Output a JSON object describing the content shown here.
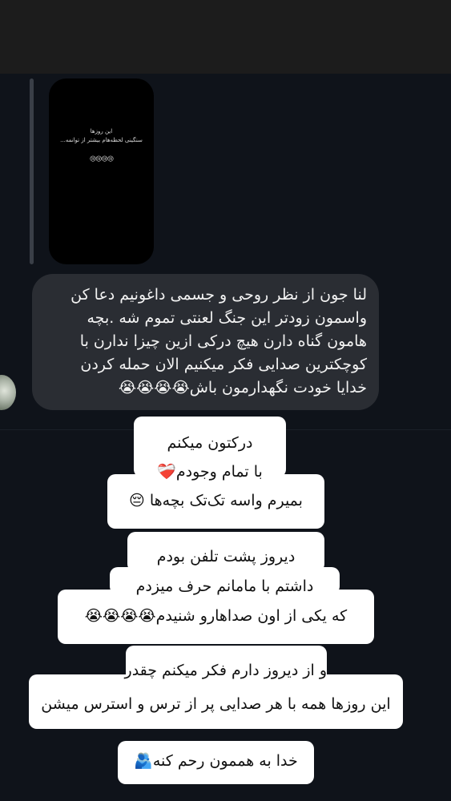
{
  "story": {
    "line1": "این روزها",
    "line2": "سنگینی لحظه‌هام بیشتر از توانمه...",
    "emoji": "😢😢😢😢"
  },
  "message": {
    "lines": [
      "لنا جون از نظر روحی و جسمی داغونیم دعا کن",
      "واسمون زودتر این جنگ لعنتی تموم شه .بچه",
      "هامون گناه دارن هیچ درکی ازین چیزا ندارن با",
      "کوچکترین صدایی فکر میکنیم الان حمله کردن",
      "خدایا خودت نگهدارمون باش😭😭😭😭"
    ]
  },
  "captions": {
    "block1": [
      "درکتون میکنم",
      "با تمام وجودم❤️‍🩹",
      "بمیرم واسه تک‌تک بچه‌ها 😔"
    ],
    "block2": [
      "دیروز پشت تلفن بودم",
      "داشتم  با مامانم حرف میزدم",
      "که یکی از اون صداهارو شنیدم😭😭😭😭"
    ],
    "block3": [
      "و از دیروز دارم فکر میکنم چقدر",
      "این روزها همه با هر صدایی پر از ترس و استرس میشن"
    ],
    "block4": [
      "خدا به هممون رحم کنه🫂"
    ]
  }
}
